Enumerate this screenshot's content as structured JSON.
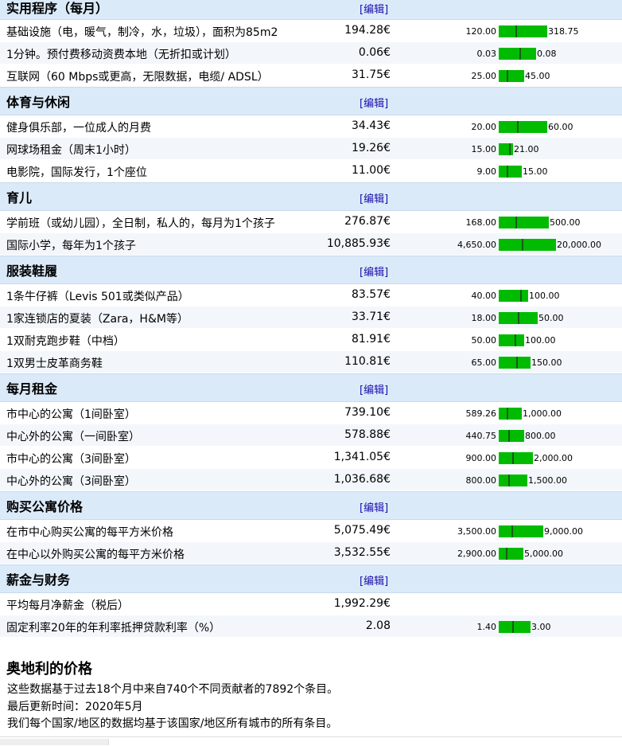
{
  "edit_label": "[编辑]",
  "sections": [
    {
      "title": "实用程序（每月）",
      "rows": [
        {
          "label": "基础设施（电，暖气，制冷，水，垃圾），面积为85m2",
          "price": "194.28€",
          "min": "120.00",
          "max": "318.75",
          "range_fill": 0.85,
          "avg_pos": 0.35
        },
        {
          "label": "1分钟。预付费移动资费本地（无折扣或计划）",
          "price": "0.06€",
          "min": "0.03",
          "max": "0.08",
          "range_fill": 0.65,
          "avg_pos": 0.55
        },
        {
          "label": "互联网（60 Mbps或更高，无限数据，电缆/ ADSL）",
          "price": "31.75€",
          "min": "25.00",
          "max": "45.00",
          "range_fill": 0.45,
          "avg_pos": 0.32
        }
      ]
    },
    {
      "title": "体育与休闲",
      "rows": [
        {
          "label": "健身俱乐部，一位成人的月费",
          "price": "34.43€",
          "min": "20.00",
          "max": "60.00",
          "range_fill": 0.85,
          "avg_pos": 0.38
        },
        {
          "label": "网球场租金（周末1小时）",
          "price": "19.26€",
          "min": "15.00",
          "max": "21.00",
          "range_fill": 0.25,
          "avg_pos": 0.7
        },
        {
          "label": "电影院，国际发行，1个座位",
          "price": "11.00€",
          "min": "9.00",
          "max": "15.00",
          "range_fill": 0.4,
          "avg_pos": 0.35
        }
      ]
    },
    {
      "title": "育儿",
      "rows": [
        {
          "label": "学前班（或幼儿园），全日制，私人的，每月为1个孩子",
          "price": "276.87€",
          "min": "168.00",
          "max": "500.00",
          "range_fill": 0.87,
          "avg_pos": 0.33
        },
        {
          "label": "国际小学，每年为1个孩子",
          "price": "10,885.93€",
          "min": "4,650.00",
          "max": "20,000.00",
          "range_fill": 1.0,
          "avg_pos": 0.4
        }
      ]
    },
    {
      "title": "服装鞋履",
      "rows": [
        {
          "label": "1条牛仔裤（Levis 501或类似产品）",
          "price": "83.57€",
          "min": "40.00",
          "max": "100.00",
          "range_fill": 0.52,
          "avg_pos": 0.72
        },
        {
          "label": "1家连锁店的夏装（Zara，H&M等）",
          "price": "33.71€",
          "min": "18.00",
          "max": "50.00",
          "range_fill": 0.68,
          "avg_pos": 0.48
        },
        {
          "label": "1双耐克跑步鞋（中档）",
          "price": "81.91€",
          "min": "50.00",
          "max": "100.00",
          "range_fill": 0.45,
          "avg_pos": 0.62
        },
        {
          "label": "1双男士皮革商务鞋",
          "price": "110.81€",
          "min": "65.00",
          "max": "150.00",
          "range_fill": 0.55,
          "avg_pos": 0.55
        }
      ]
    },
    {
      "title": "每月租金",
      "rows": [
        {
          "label": "市中心的公寓（1间卧室）",
          "price": "739.10€",
          "min": "589.26",
          "max": "1,000.00",
          "range_fill": 0.4,
          "avg_pos": 0.36
        },
        {
          "label": "中心外的公寓（一间卧室）",
          "price": "578.88€",
          "min": "440.75",
          "max": "800.00",
          "range_fill": 0.45,
          "avg_pos": 0.38
        },
        {
          "label": "市中心的公寓（3间卧室）",
          "price": "1,341.05€",
          "min": "900.00",
          "max": "2,000.00",
          "range_fill": 0.6,
          "avg_pos": 0.4
        },
        {
          "label": "中心外的公寓（3间卧室）",
          "price": "1,036.68€",
          "min": "800.00",
          "max": "1,500.00",
          "range_fill": 0.5,
          "avg_pos": 0.34
        }
      ]
    },
    {
      "title": "购买公寓价格",
      "rows": [
        {
          "label": "在市中心购买公寓的每平方米价格",
          "price": "5,075.49€",
          "min": "3,500.00",
          "max": "9,000.00",
          "range_fill": 0.78,
          "avg_pos": 0.29
        },
        {
          "label": "在中心以外购买公寓的每平方米价格",
          "price": "3,532.55€",
          "min": "2,900.00",
          "max": "5,000.00",
          "range_fill": 0.43,
          "avg_pos": 0.3
        }
      ]
    },
    {
      "title": "薪金与财务",
      "rows": [
        {
          "label": "平均每月净薪金（税后）",
          "price": "1,992.29€",
          "min": "",
          "max": "",
          "range_fill": 0,
          "avg_pos": 0
        },
        {
          "label": "固定利率20年的年利率抵押贷款利率（%）",
          "price": "2.08",
          "min": "1.40",
          "max": "3.00",
          "range_fill": 0.55,
          "avg_pos": 0.42
        }
      ]
    }
  ],
  "footer": {
    "title": "奥地利的价格",
    "line1": "这些数据基于过去18个月中来自740个不同贡献者的7892个条目。",
    "line2": "最后更新时间：2020年5月",
    "line3": "我们每个国家/地区的数据均基于该国家/地区所有城市的所有条目。"
  }
}
